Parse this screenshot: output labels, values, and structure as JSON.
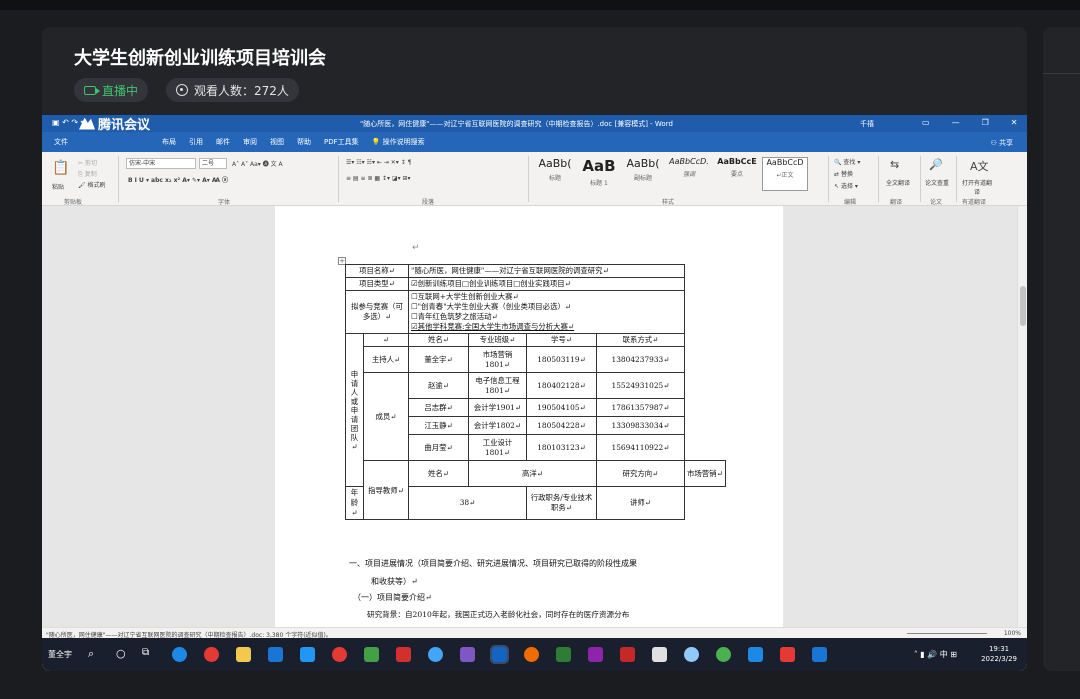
{
  "meeting": {
    "title": "大学生创新创业训练项目培训会",
    "live_label": "直播中",
    "viewers_label": "观看人数：272人"
  },
  "word": {
    "doc_title": "\"随心所医，网住健康\"——对辽宁省互联网医院的调查研究（中期检查报告）.doc [兼容模式] - Word",
    "app_logo": "腾讯会议",
    "user": "千禧",
    "tabs": [
      "文件",
      "开始",
      "插入",
      "设计",
      "布局",
      "引用",
      "邮件",
      "审阅",
      "视图",
      "帮助",
      "PDF工具集",
      "操作说明搜索"
    ],
    "share": "共享",
    "ribbon": {
      "font_name": "仿宋-中宋",
      "font_size": "二号",
      "paste": "粘贴",
      "cut": "剪切",
      "copy": "复制",
      "format_painter": "格式刷",
      "groups": [
        "剪贴板",
        "字体",
        "段落",
        "样式",
        "编辑",
        "翻译",
        "论文",
        "有道翻译"
      ],
      "styles": [
        {
          "sample": "AaBb(",
          "name": "标题"
        },
        {
          "sample": "AaB",
          "name": "标题 1"
        },
        {
          "sample": "AaBb(",
          "name": "副标题"
        },
        {
          "sample": "AaBbCcD.",
          "name": "强调"
        },
        {
          "sample": "AaBbCcE",
          "name": "要点"
        },
        {
          "sample": "AaBbCcD",
          "name": "↵正文"
        }
      ],
      "find": "查找",
      "replace": "替换",
      "select": "选择",
      "full_translate": "全文翻译",
      "check": "论文查重",
      "open_translate": "打开有道翻译"
    },
    "table": {
      "project_name_label": "项目名称↵",
      "project_name": "\"随心所医，网住健康\"——对辽宁省互联网医院的调查研究↵",
      "project_type_label": "项目类型↵",
      "project_type": "☑创新训练项目□创业训练项目□创业实践项目↵",
      "competition_label": "拟参与竞赛（可多选）↵",
      "competitions": [
        "☐互联网+大学生创新创业大赛↵",
        "☐\"创青春\"大学生创业大赛（创业类项目必选）↵",
        "☐青年红色筑梦之旅活动↵",
        "☑其他学科竞赛:全国大学生市场调查与分析大赛↵"
      ],
      "applicant_label": "申请人或申请团队↵",
      "headers": [
        "↵",
        "姓名↵",
        "专业班级↵",
        "学号↵",
        "联系方式↵"
      ],
      "host_label": "主持人↵",
      "member_label": "成员↵",
      "host": {
        "name": "董全宇↵",
        "major": "市场营销1801↵",
        "id": "180503119↵",
        "phone": "13804237933↵"
      },
      "members": [
        {
          "name": "赵逾↵",
          "major": "电子信息工程1801↵",
          "id": "180402128↵",
          "phone": "15524931025↵"
        },
        {
          "name": "吕志群↵",
          "major": "会计学1901↵",
          "id": "190504105↵",
          "phone": "17861357987↵"
        },
        {
          "name": "江玉静↵",
          "major": "会计学1802↵",
          "id": "180504228↵",
          "phone": "13309833034↵"
        },
        {
          "name": "曲月莹↵",
          "major": "工业设计1801↵",
          "id": "180103123↵",
          "phone": "15694110922↵"
        }
      ],
      "advisor_label": "指导教师↵",
      "advisor": {
        "name_label": "姓名↵",
        "name": "高洋↵",
        "dir_label": "研究方向↵",
        "dir": "市场营销↵",
        "age_label": "年龄↵",
        "age": "38↵",
        "title_label": "行政职务/专业技术职务↵",
        "title": "讲师↵"
      }
    },
    "body": [
      "一、项目进展情况（项目简要介绍、研究进展情况、项目研究已取得的阶段性成果",
      "和收获等）↵",
      "（一）项目简要介绍↵",
      "研究背景：自2010年起，我国正式迈入老龄化社会，同时存在的医疗资源分布"
    ],
    "status_text": "\"随心所医，网住健康\"——对辽宁省互联网医院的调查研究（中期检查报告）.doc: 3,380 个字符(近似值)。",
    "zoom": "100%"
  },
  "taskbar": {
    "user": "董全宇",
    "time": "19:31",
    "date": "2022/3/29",
    "ime": "中"
  }
}
